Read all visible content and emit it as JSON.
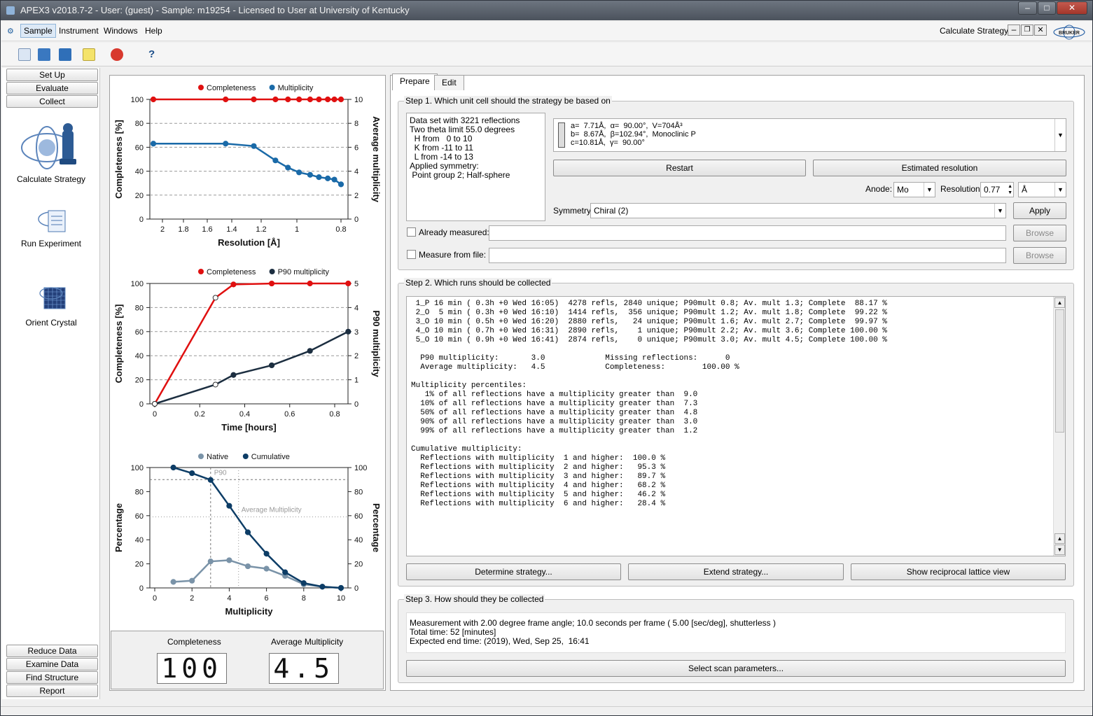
{
  "window": {
    "title": "APEX3 v2018.7-2 - User: (guest) - Sample: m19254 - Licensed to User at University of Kentucky"
  },
  "menu": {
    "items": [
      "Sample",
      "Instrument",
      "Windows",
      "Help"
    ],
    "right_label": "Calculate Strategy"
  },
  "left_panel": {
    "top_buttons": [
      "Set Up",
      "Evaluate",
      "Collect"
    ],
    "big_items": [
      "Calculate Strategy",
      "Run Experiment",
      "Orient Crystal"
    ],
    "bottom_buttons": [
      "Reduce Data",
      "Examine Data",
      "Find Structure",
      "Report"
    ]
  },
  "chart_data": [
    {
      "type": "line",
      "legend": [
        "Completeness",
        "Multiplicity"
      ],
      "xlabel": "Resolution [Å]",
      "ylabel": "Completeness [%]",
      "y2label": "Average multiplicity",
      "x_ticks": [
        "2",
        "1.8",
        "1.6",
        "1.4",
        "1.2",
        "1",
        "0.8"
      ],
      "y_ticks": [
        "0",
        "20",
        "40",
        "60",
        "80",
        "100"
      ],
      "y2_ticks": [
        "0",
        "2",
        "4",
        "6",
        "8",
        "10"
      ],
      "ylim": [
        0,
        100
      ],
      "y2lim": [
        0,
        10
      ],
      "series": [
        {
          "name": "Completeness",
          "color": "#e01010",
          "x": [
            2.1,
            1.45,
            1.25,
            1.12,
            1.05,
            0.99,
            0.94,
            0.9,
            0.86,
            0.83,
            0.8
          ],
          "values": [
            100,
            100,
            100,
            100,
            100,
            100,
            100,
            100,
            100,
            100,
            100
          ]
        },
        {
          "name": "Multiplicity",
          "color": "#1a6aa8",
          "x": [
            2.1,
            1.45,
            1.25,
            1.12,
            1.05,
            0.99,
            0.94,
            0.9,
            0.86,
            0.83,
            0.8
          ],
          "values": [
            6.3,
            6.3,
            6.1,
            4.9,
            4.3,
            3.9,
            3.7,
            3.5,
            3.4,
            3.3,
            2.9
          ]
        }
      ]
    },
    {
      "type": "line",
      "legend": [
        "Completeness",
        "P90 multiplicity"
      ],
      "xlabel": "Time [hours]",
      "ylabel": "Completeness [%]",
      "y2label": "P90 multiplicity",
      "x_ticks": [
        "0",
        "0.2",
        "0.4",
        "0.6",
        "0.8"
      ],
      "y_ticks": [
        "0",
        "20",
        "40",
        "60",
        "80",
        "100"
      ],
      "y2_ticks": [
        "0",
        "1",
        "2",
        "3",
        "4",
        "5"
      ],
      "xlim": [
        0,
        0.88
      ],
      "ylim": [
        0,
        100
      ],
      "y2lim": [
        0,
        5
      ],
      "series": [
        {
          "name": "Completeness",
          "color": "#e01010",
          "x": [
            0,
            0.27,
            0.35,
            0.52,
            0.69,
            0.86
          ],
          "values": [
            0,
            88.17,
            99.22,
            99.97,
            100,
            100
          ]
        },
        {
          "name": "P90 multiplicity",
          "color": "#1c2e40",
          "x": [
            0,
            0.27,
            0.35,
            0.52,
            0.69,
            0.86
          ],
          "values": [
            0,
            0.8,
            1.2,
            1.6,
            2.2,
            3.0
          ]
        }
      ]
    },
    {
      "type": "line",
      "legend": [
        "Native",
        "Cumulative"
      ],
      "xlabel": "Multiplicity",
      "ylabel": "Percentage",
      "y2label": "Percentage",
      "x_ticks": [
        "0",
        "2",
        "4",
        "6",
        "8",
        "10"
      ],
      "y_ticks": [
        "0",
        "20",
        "40",
        "60",
        "80",
        "100"
      ],
      "xlim": [
        0,
        10
      ],
      "ylim": [
        0,
        100
      ],
      "annotations": [
        "P90",
        "Average Multiplicity"
      ],
      "series": [
        {
          "name": "Native",
          "color": "#7a93a8",
          "x": [
            1,
            2,
            3,
            4,
            5,
            6,
            7,
            8,
            9,
            10
          ],
          "values": [
            5,
            6,
            22,
            23,
            18,
            16,
            10,
            3,
            1,
            0
          ]
        },
        {
          "name": "Cumulative",
          "color": "#0d3d66",
          "x": [
            1,
            2,
            3,
            4,
            5,
            6,
            7,
            8,
            9,
            10
          ],
          "values": [
            100,
            95.3,
            89.7,
            68.2,
            46.2,
            28.4,
            13,
            4,
            1,
            0
          ]
        }
      ]
    }
  ],
  "gauges": {
    "completeness_label": "Completeness",
    "completeness_value": "100",
    "avgmult_label": "Average Multiplicity",
    "avgmult_value": "4.5"
  },
  "tabs": [
    "Prepare",
    "Edit"
  ],
  "step1": {
    "title": "Step 1. Which unit cell should the strategy be based on",
    "dataset_lines": [
      "Data set with 3221 reflections",
      "Two theta limit 55.0 degrees",
      "  H from   0 to 10",
      "  K from -11 to 11",
      "  L from -14 to 13",
      "Applied symmetry:",
      " Point group 2; Half-sphere"
    ],
    "cell_lines": [
      "a=  7.71Å,  α=  90.00°,  V=704Å³",
      "b=  8.67Å,  β=102.94°,  Monoclinic P",
      "c=10.81Å,  γ=  90.00°"
    ],
    "restart": "Restart",
    "estimated_resolution": "Estimated resolution",
    "anode_label": "Anode:",
    "anode_value": "Mo",
    "resolution_label": "Resolution:",
    "resolution_value": "0.77",
    "resolution_unit": "Å",
    "symmetry_label": "Symmetry:",
    "symmetry_value": "Chiral (2)",
    "apply": "Apply",
    "already_measured": "Already measured:",
    "measure_from_file": "Measure from file:",
    "browse": "Browse"
  },
  "step2": {
    "title": "Step 2. Which runs should be collected",
    "lines": [
      " 1_P 16 min ( 0.3h +0 Wed 16:05)  4278 refls, 2840 unique; P90mult 0.8; Av. mult 1.3; Complete  88.17 %",
      " 2_O  5 min ( 0.3h +0 Wed 16:10)  1414 refls,  356 unique; P90mult 1.2; Av. mult 1.8; Complete  99.22 %",
      " 3_O 10 min ( 0.5h +0 Wed 16:20)  2880 refls,   24 unique; P90mult 1.6; Av. mult 2.7; Complete  99.97 %",
      " 4_O 10 min ( 0.7h +0 Wed 16:31)  2890 refls,    1 unique; P90mult 2.2; Av. mult 3.6; Complete 100.00 %",
      " 5_O 10 min ( 0.9h +0 Wed 16:41)  2874 refls,    0 unique; P90mult 3.0; Av. mult 4.5; Complete 100.00 %",
      "",
      "  P90 multiplicity:       3.0             Missing reflections:      0",
      "  Average multiplicity:   4.5             Completeness:        100.00 %",
      "",
      "Multiplicity percentiles:",
      "   1% of all reflections have a multiplicity greater than  9.0",
      "  10% of all reflections have a multiplicity greater than  7.3",
      "  50% of all reflections have a multiplicity greater than  4.8",
      "  90% of all reflections have a multiplicity greater than  3.0",
      "  99% of all reflections have a multiplicity greater than  1.2",
      "",
      "Cumulative multiplicity:",
      "  Reflections with multiplicity  1 and higher:  100.0 %",
      "  Reflections with multiplicity  2 and higher:   95.3 %",
      "  Reflections with multiplicity  3 and higher:   89.7 %",
      "  Reflections with multiplicity  4 and higher:   68.2 %",
      "  Reflections with multiplicity  5 and higher:   46.2 %",
      "  Reflections with multiplicity  6 and higher:   28.4 %"
    ],
    "determine": "Determine strategy...",
    "extend": "Extend strategy...",
    "reciprocal": "Show reciprocal lattice view"
  },
  "step3": {
    "title": "Step 3. How should they be collected",
    "lines": [
      "Measurement with 2.00 degree frame angle; 10.0 seconds per frame ( 5.00 [sec/deg], shutterless )",
      "Total time: 52 [minutes]",
      "Expected end time: (2019), Wed, Sep 25,  16:41"
    ],
    "select_scan": "Select scan parameters..."
  }
}
